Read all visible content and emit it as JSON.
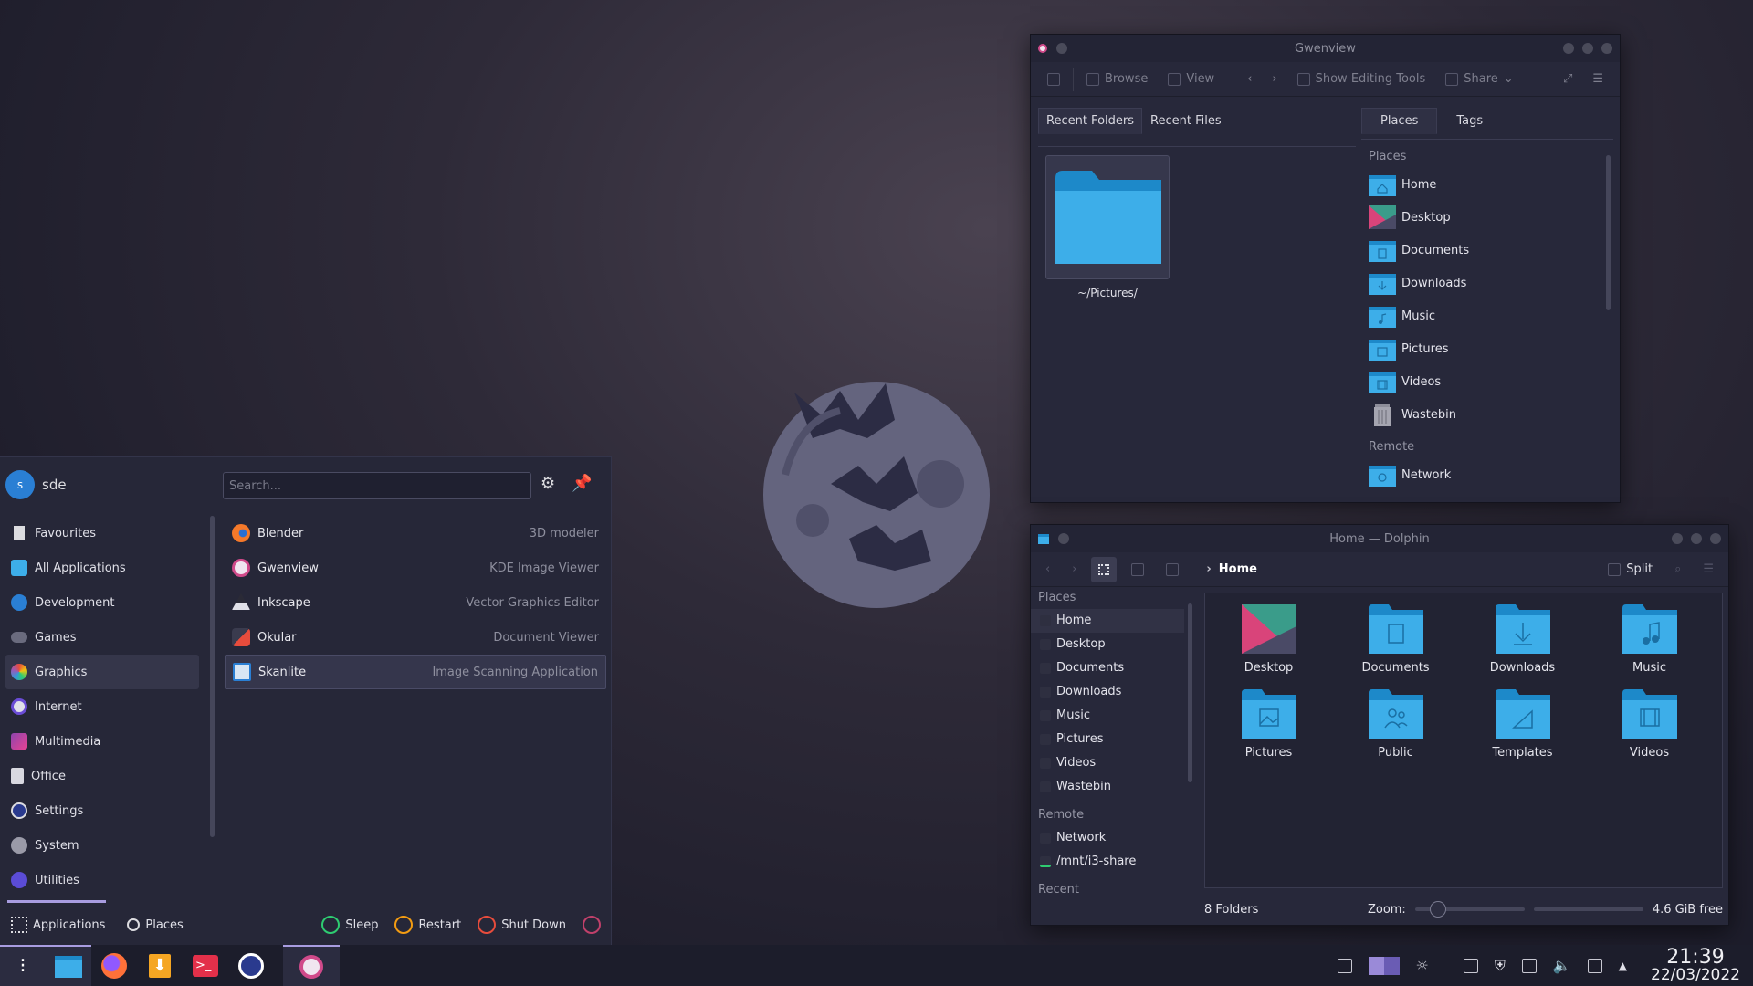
{
  "colors": {
    "accent": "#a89ce0",
    "folder": "#3daee9",
    "folder_dark": "#1d89c9"
  },
  "gwenview": {
    "title": "Gwenview",
    "toolbar": {
      "browse": "Browse",
      "view": "View",
      "editing": "Show Editing Tools",
      "share": "Share"
    },
    "left_tabs": [
      "Recent Folders",
      "Recent Files"
    ],
    "recent_folder": "~/Pictures/",
    "right_tabs": [
      "Places",
      "Tags"
    ],
    "places_header": "Places",
    "places": [
      "Home",
      "Desktop",
      "Documents",
      "Downloads",
      "Music",
      "Pictures",
      "Videos",
      "Wastebin"
    ],
    "remote_header": "Remote",
    "remote": [
      "Network"
    ]
  },
  "dolphin": {
    "title": "Home — Dolphin",
    "breadcrumb": "Home",
    "split": "Split",
    "places_header": "Places",
    "places": [
      "Home",
      "Desktop",
      "Documents",
      "Downloads",
      "Music",
      "Pictures",
      "Videos",
      "Wastebin"
    ],
    "remote_header": "Remote",
    "remote": [
      "Network",
      "/mnt/i3-share"
    ],
    "recent_header": "Recent",
    "folders": [
      "Desktop",
      "Documents",
      "Downloads",
      "Music",
      "Pictures",
      "Public",
      "Templates",
      "Videos"
    ],
    "status": {
      "count": "8 Folders",
      "zoom": "Zoom:",
      "free": "4.6 GiB free"
    }
  },
  "launcher": {
    "user": "sde",
    "avatar_letter": "s",
    "search_placeholder": "Search...",
    "categories": [
      "Favourites",
      "All Applications",
      "Development",
      "Games",
      "Graphics",
      "Internet",
      "Multimedia",
      "Office",
      "Settings",
      "System",
      "Utilities"
    ],
    "active_category": "Graphics",
    "apps": [
      {
        "name": "Blender",
        "desc": "3D modeler"
      },
      {
        "name": "Gwenview",
        "desc": "KDE Image Viewer"
      },
      {
        "name": "Inkscape",
        "desc": "Vector Graphics Editor"
      },
      {
        "name": "Okular",
        "desc": "Document Viewer"
      },
      {
        "name": "Skanlite",
        "desc": "Image Scanning Application"
      }
    ],
    "footer": {
      "applications": "Applications",
      "places": "Places",
      "sleep": "Sleep",
      "restart": "Restart",
      "shutdown": "Shut Down"
    }
  },
  "taskbar": {
    "pinned": [
      "application-launcher-icon",
      "dolphin-icon",
      "firefox-icon",
      "discover-icon",
      "konsole-icon",
      "system-settings-icon",
      "gwenview-icon"
    ],
    "time": "21:39",
    "date": "22/03/2022"
  }
}
